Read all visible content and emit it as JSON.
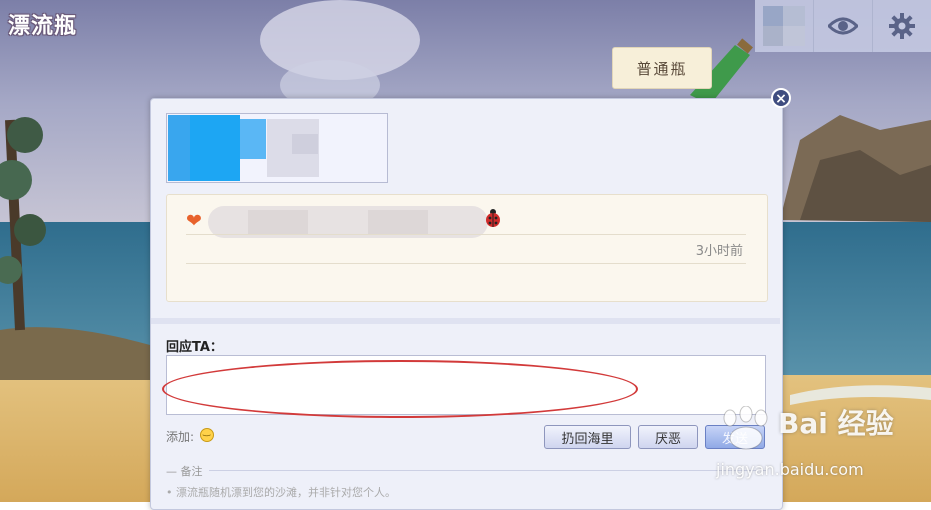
{
  "app": {
    "logo_text": "漂流瓶"
  },
  "topbar": {
    "avatar_alt": "用户头像",
    "eye_icon": "eye-icon",
    "gear_icon": "gear-icon"
  },
  "bottle": {
    "type_label": "普通瓶"
  },
  "message": {
    "emoji_start": "heart-icon",
    "emoji_end": "ladybug-icon",
    "time": "3小时前"
  },
  "reply": {
    "label": "回应TA：",
    "value": "",
    "add_label": "添加:",
    "emoji_button": "smile-icon"
  },
  "actions": {
    "return_label": "扔回海里",
    "dislike_label": "厌恶",
    "send_label": "发送"
  },
  "notes": {
    "title": "备注",
    "text": "• 漂流瓶随机漂到您的沙滩，并非针对您个人。"
  },
  "watermark": {
    "main": "Bai 经验",
    "sub": "jingyan.baidu.com"
  },
  "colors": {
    "panel_bg": "#eef0f9",
    "message_bg": "#fbf7ee",
    "annotation": "#d23a3a",
    "button_border": "#8e96bd"
  }
}
